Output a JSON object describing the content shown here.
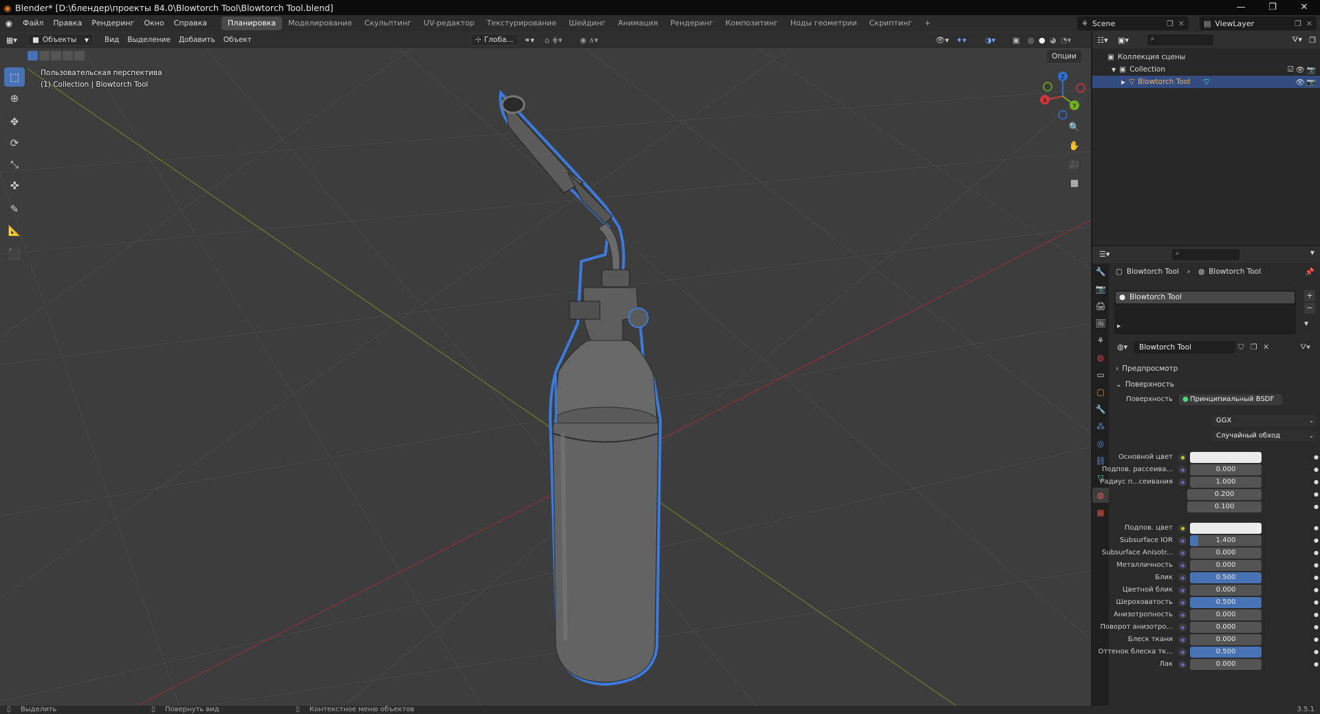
{
  "window": {
    "title": "Blender* [D:\\блендер\\проекты 84.0\\Blowtorch Tool\\Blowtorch Tool.blend]",
    "min": "—",
    "max": "❐",
    "close": "✕"
  },
  "menu": [
    "Файл",
    "Правка",
    "Рендеринг",
    "Окно",
    "Справка"
  ],
  "workspaces": [
    "Планировка",
    "Моделирование",
    "Скульптинг",
    "UV-редактор",
    "Текстурирование",
    "Шейдинг",
    "Анимация",
    "Рендеринг",
    "Композитинг",
    "Ноды геометрии",
    "Скриптинг",
    "+"
  ],
  "scene": {
    "name": "Scene",
    "view_layer": "ViewLayer"
  },
  "viewport_header": {
    "mode": "Объекты",
    "menus": [
      "Вид",
      "Выделение",
      "Добавить",
      "Объект"
    ],
    "orientation": "Глоба...",
    "options": "Опции"
  },
  "viewport": {
    "perspective": "Пользовательская перспектива",
    "object_info": "(1) Collection | Blowtorch Tool"
  },
  "gizmo": {
    "x": "X",
    "y": "Y",
    "z": "Z"
  },
  "outliner": {
    "scene_collection": "Коллекция сцены",
    "collection": "Collection",
    "object": "Blowtorch Tool"
  },
  "properties": {
    "breadcrumb": [
      "Blowtorch Tool",
      "Blowtorch Tool"
    ],
    "slot": "Blowtorch Tool",
    "material": "Blowtorch Tool",
    "preview": "Предпросмотр",
    "surface_panel": "Поверхность",
    "surface_label": "Поверхность",
    "surface_value": "Принципиальный BSDF",
    "distribution": "GGX",
    "subsurface_method": "Случайный обход",
    "fields": [
      {
        "label": "Основной цвет",
        "type": "color"
      },
      {
        "label": "Подпов. рассеива...",
        "value": "0.000",
        "fill": 0
      },
      {
        "label": "Радиус п...сеивания",
        "value": "1.000",
        "fill": 0
      },
      {
        "label": "",
        "value": "0.200",
        "fill": 0
      },
      {
        "label": "",
        "value": "0.100",
        "fill": 0
      },
      {
        "label": "Подпов. цвет",
        "type": "color"
      },
      {
        "label": "Subsurface IOR",
        "value": "1.400",
        "fill": 0.12
      },
      {
        "label": "Subsurface Anisotr...",
        "value": "0.000",
        "fill": 0
      },
      {
        "label": "Металличность",
        "value": "0.000",
        "fill": 0
      },
      {
        "label": "Блик",
        "value": "0.500",
        "fill": 1
      },
      {
        "label": "Цветной блик",
        "value": "0.000",
        "fill": 0
      },
      {
        "label": "Шероховатость",
        "value": "0.500",
        "fill": 1
      },
      {
        "label": "Анизотропность",
        "value": "0.000",
        "fill": 0
      },
      {
        "label": "Поворот анизотро...",
        "value": "0.000",
        "fill": 0
      },
      {
        "label": "Блеск ткани",
        "value": "0.000",
        "fill": 0
      },
      {
        "label": "Оттенок блеска тк...",
        "value": "0.500",
        "fill": 1
      },
      {
        "label": "Лак",
        "value": "0.000",
        "fill": 0
      }
    ]
  },
  "statusbar": {
    "select": "Выделить",
    "rotate": "Повернуть вид",
    "context": "Контекстное меню объектов",
    "version": "3.5.1"
  },
  "colors": {
    "accent": "#4772b3",
    "viewport": "#3d3d3d",
    "selection_outline": "#3b7be0"
  }
}
